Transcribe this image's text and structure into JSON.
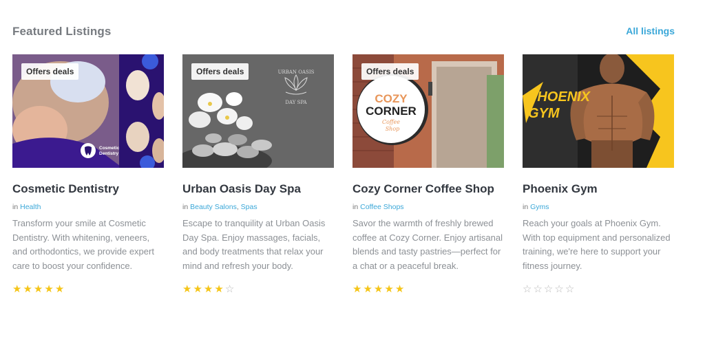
{
  "section": {
    "title": "Featured Listings",
    "all_link": "All listings"
  },
  "badge_label": "Offers deals",
  "in_label": "in",
  "listings": [
    {
      "title": "Cosmetic Dentistry",
      "categories": [
        "Health"
      ],
      "description": "Transform your smile at Cosmetic Dentistry. With whitening, veneers, and orthodontics, we provide expert care to boost your confidence.",
      "rating": 5,
      "image_text": "Cosmetic\nDentistry",
      "has_badge": true
    },
    {
      "title": "Urban Oasis Day Spa",
      "categories": [
        "Beauty Salons",
        "Spas"
      ],
      "description": "Escape to tranquility at Urban Oasis Day Spa. Enjoy massages, facials, and body treatments that relax your mind and refresh your body.",
      "rating": 4,
      "image_text": "URBAN OASIS DAY SPA",
      "has_badge": true
    },
    {
      "title": "Cozy Corner Coffee Shop",
      "categories": [
        "Coffee Shops"
      ],
      "description": "Savor the warmth of freshly brewed coffee at Cozy Corner. Enjoy artisanal blends and tasty pastries—perfect for a chat or a peaceful break.",
      "rating": 5,
      "image_text": "COZY CORNER Coffee Shop",
      "has_badge": true
    },
    {
      "title": "Phoenix Gym",
      "categories": [
        "Gyms"
      ],
      "description": "Reach your goals at Phoenix Gym. With top equipment and personalized training, we're here to support your fitness journey.",
      "rating": 0,
      "image_text": "PHOENIX GYM",
      "has_badge": false
    }
  ],
  "colors": {
    "accent": "#3aa7d8",
    "star": "#f5c518",
    "star_empty": "#b9b9b9",
    "dentistry_purple": "#3b1a8f",
    "gym_yellow": "#f7c51e"
  },
  "icons": [
    "star-icon",
    "star-outline-icon",
    "tooth-icon",
    "lotus-icon"
  ]
}
